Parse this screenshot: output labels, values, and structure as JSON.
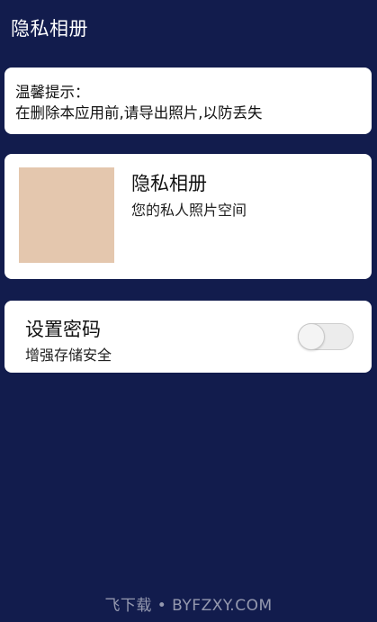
{
  "header": {
    "title": "隐私相册"
  },
  "tip": {
    "title": "温馨提示：",
    "text": "在删除本应用前,请导出照片,以防丢失"
  },
  "album": {
    "name": "隐私相册",
    "description": "您的私人照片空间",
    "thumbnail_color": "#e4c7ae"
  },
  "password": {
    "label": "设置密码",
    "sublabel": "增强存储安全",
    "enabled": false
  },
  "watermark": {
    "text": "飞下载 • BYFZXY.COM"
  },
  "colors": {
    "background": "#121c4d",
    "card": "#ffffff"
  }
}
